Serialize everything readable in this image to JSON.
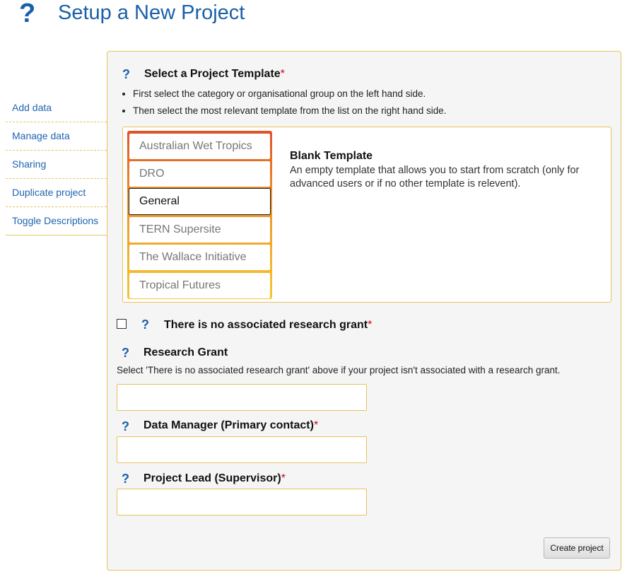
{
  "header": {
    "title": "Setup a New Project",
    "help_icon": "question-mark-icon"
  },
  "sidebar": {
    "items": [
      {
        "label": "Add data"
      },
      {
        "label": "Manage data"
      },
      {
        "label": "Sharing"
      },
      {
        "label": "Duplicate project"
      },
      {
        "label": "Toggle Descriptions"
      }
    ]
  },
  "template_section": {
    "title": "Select a Project Template",
    "required_marker": "*",
    "instructions": [
      "First select the category or organisational group on the left hand side.",
      "Then select the most relevant template from the list on the right hand side."
    ],
    "categories": [
      {
        "label": "Australian Wet Tropics",
        "selected": false
      },
      {
        "label": "DRO",
        "selected": false
      },
      {
        "label": "General",
        "selected": true
      },
      {
        "label": "TERN Supersite",
        "selected": false
      },
      {
        "label": "The Wallace Initiative",
        "selected": false
      },
      {
        "label": "Tropical Futures",
        "selected": false
      }
    ],
    "selected_template": {
      "title": "Blank Template",
      "description": "An empty template that allows you to start from scratch (only for advanced users or if no other template is relevent)."
    }
  },
  "no_grant": {
    "label": "There is no associated research grant",
    "required_marker": "*",
    "checked": false
  },
  "research_grant": {
    "title": "Research Grant",
    "help_text": "Select 'There is no associated research grant' above if your project isn't associated with a research grant.",
    "value": ""
  },
  "data_manager": {
    "title": "Data Manager (Primary contact)",
    "required_marker": "*",
    "value": ""
  },
  "project_lead": {
    "title": "Project Lead (Supervisor)",
    "required_marker": "*",
    "value": ""
  },
  "actions": {
    "create_label": "Create project"
  },
  "colors": {
    "accent": "#1a5fa8",
    "border": "#e6c25a",
    "required": "#d0021b"
  }
}
